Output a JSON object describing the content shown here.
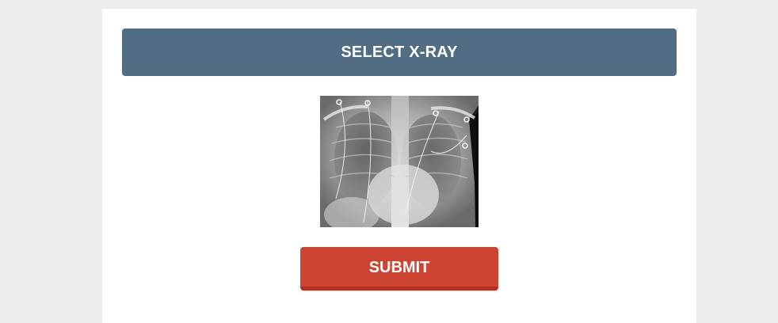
{
  "select_button": {
    "label": "SELECT X-RAY"
  },
  "submit_button": {
    "label": "SUBMIT"
  },
  "image": {
    "type": "chest-xray"
  },
  "colors": {
    "page_background": "#ececec",
    "card_background": "#ffffff",
    "select_button": "#516d84",
    "submit_button": "#cd4432",
    "submit_button_shadow": "#b72d1e",
    "button_text": "#ffffff"
  }
}
